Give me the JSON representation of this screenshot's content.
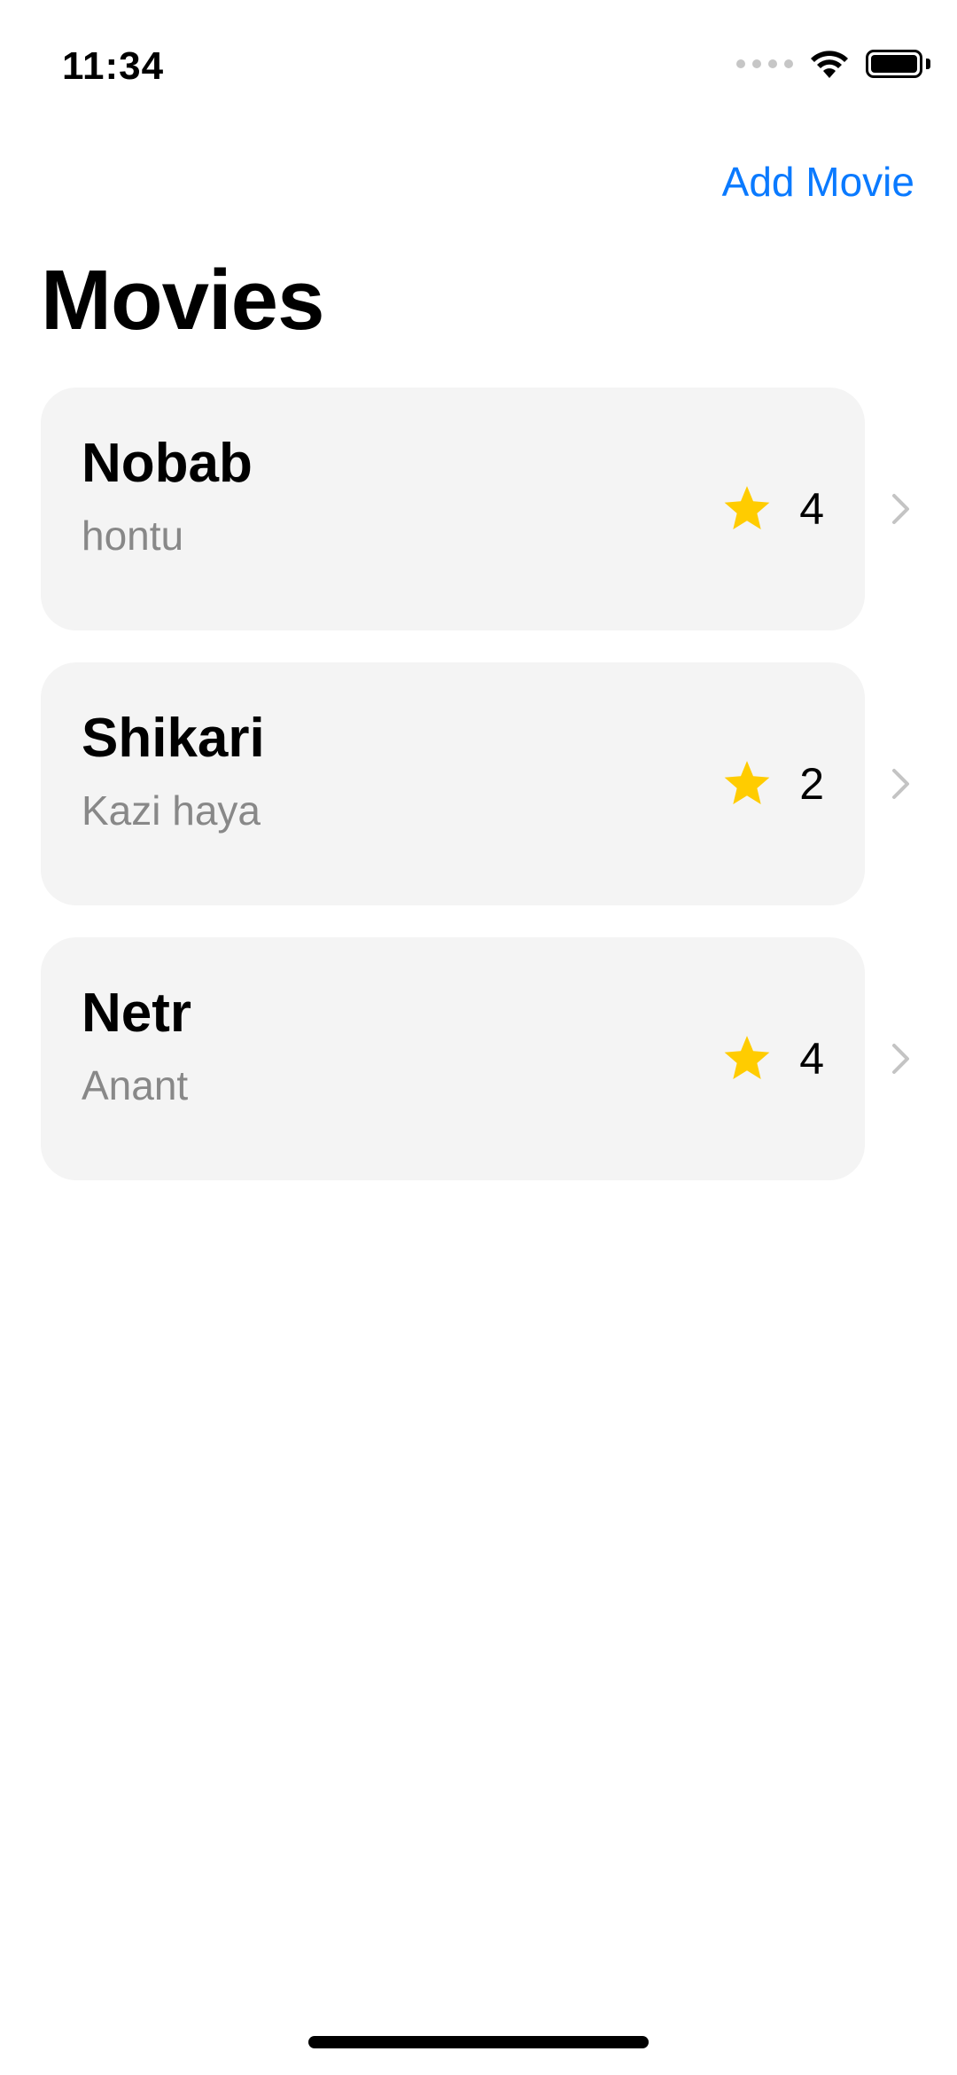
{
  "status_bar": {
    "time": "11:34"
  },
  "nav": {
    "add_movie_label": "Add Movie",
    "title": "Movies"
  },
  "colors": {
    "accent": "#0a7aff",
    "star": "#ffcc00",
    "card_background": "#f4f4f4",
    "subtitle": "#888888",
    "chevron": "#c4c4c4"
  },
  "icons": {
    "rating": "star-icon",
    "disclosure": "chevron-right-icon",
    "wifi": "wifi-icon",
    "battery": "battery-icon",
    "signal": "signal-icon"
  },
  "movies": [
    {
      "title": "Nobab",
      "subtitle": "hontu",
      "rating": "4"
    },
    {
      "title": "Shikari",
      "subtitle": "Kazi haya",
      "rating": "2"
    },
    {
      "title": "Netr",
      "subtitle": "Anant",
      "rating": "4"
    }
  ]
}
